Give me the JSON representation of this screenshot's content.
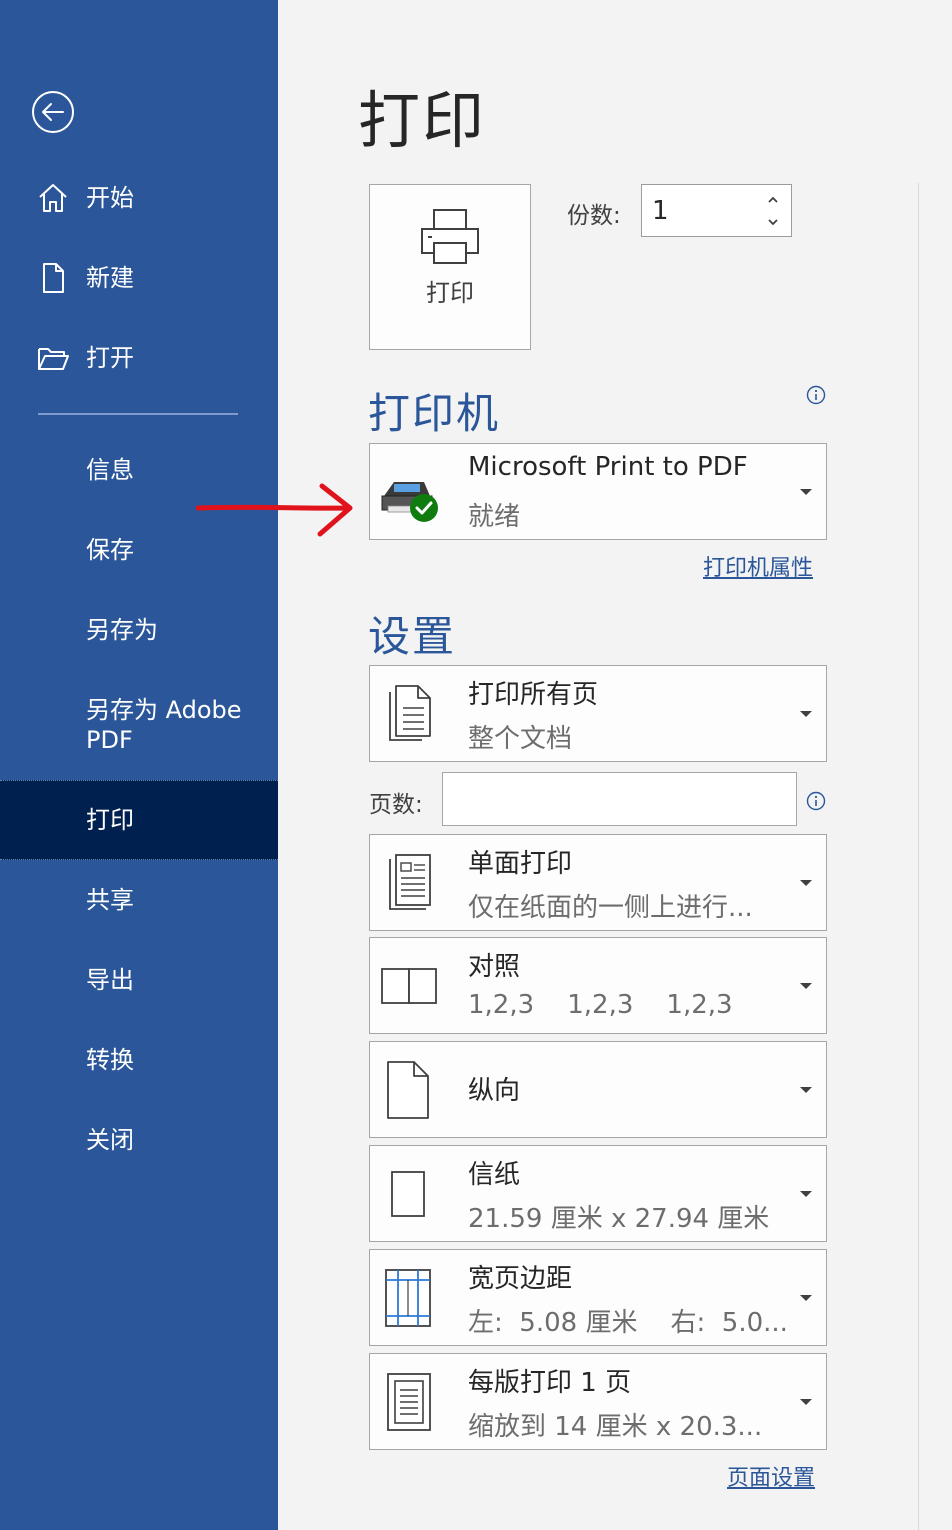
{
  "sidebar": {
    "back_label": "",
    "items_top": [
      {
        "label": "开始",
        "icon": "home-icon"
      },
      {
        "label": "新建",
        "icon": "new-document-icon"
      },
      {
        "label": "打开",
        "icon": "open-folder-icon"
      }
    ],
    "items_bottom": [
      {
        "label": "信息"
      },
      {
        "label": "保存"
      },
      {
        "label": "另存为"
      },
      {
        "label": "另存为 Adobe PDF"
      },
      {
        "label": "打印",
        "active": true
      },
      {
        "label": "共享"
      },
      {
        "label": "导出"
      },
      {
        "label": "转换"
      },
      {
        "label": "关闭"
      }
    ]
  },
  "main": {
    "title": "打印",
    "print_button_label": "打印",
    "copies_label": "份数:",
    "copies_value": "1",
    "printer_section_title": "打印机",
    "printer": {
      "name": "Microsoft Print to PDF",
      "status": "就绪",
      "properties_link": "打印机属性"
    },
    "settings_section_title": "设置",
    "settings": {
      "range_main": "打印所有页",
      "range_sub": "整个文档",
      "pages_label": "页数:",
      "pages_value": "",
      "sides_main": "单面打印",
      "sides_sub": "仅在纸面的一侧上进行...",
      "collate_main": "对照",
      "collate_sub": "1,2,3    1,2,3    1,2,3",
      "orientation_main": "纵向",
      "paper_main": "信纸",
      "paper_sub": "21.59 厘米 x 27.94 厘米",
      "margins_main": "宽页边距",
      "margins_sub": "左:  5.08 厘米    右:  5.0...",
      "per_sheet_main": "每版打印 1 页",
      "per_sheet_sub": "缩放到 14 厘米 x 20.3...",
      "page_setup_link": "页面设置"
    }
  },
  "colors": {
    "sidebar_bg": "#2b579a",
    "sidebar_active_bg": "#002050",
    "accent": "#2b579a",
    "annotation_arrow": "#e0121b",
    "status_ok": "#107c10"
  }
}
